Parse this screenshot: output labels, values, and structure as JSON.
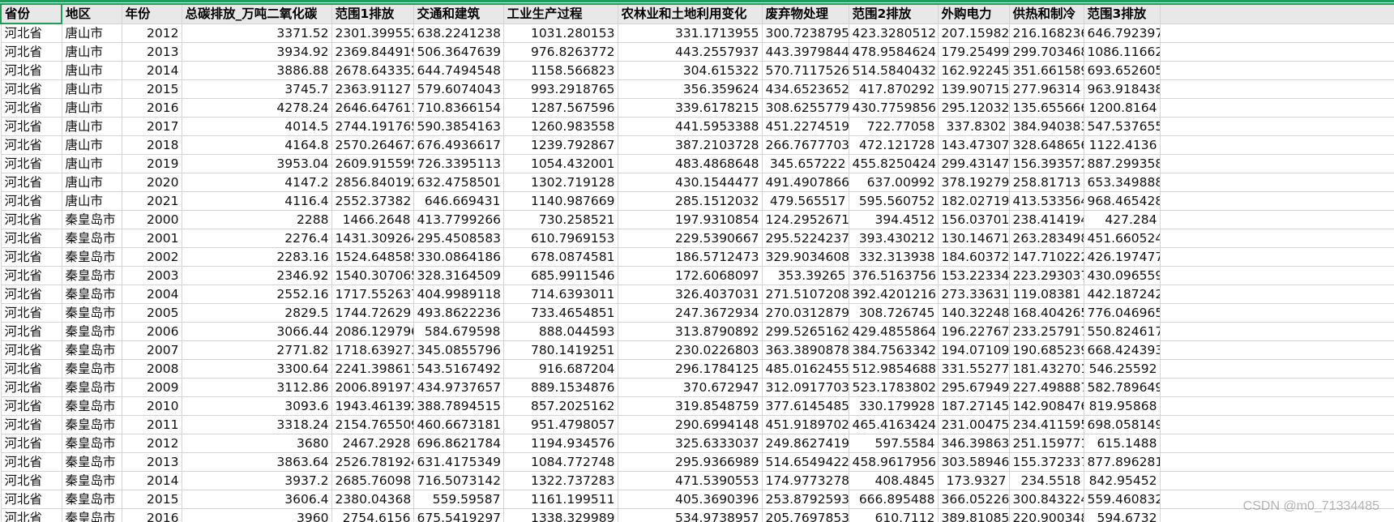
{
  "sheet": {
    "headers": [
      "省份",
      "地区",
      "年份",
      "总碳排放_万吨二氧化碳",
      "范围1排放",
      "交通和建筑",
      "工业生产过程",
      "农林业和土地利用变化",
      "废弃物处理",
      "范围2排放",
      "外购电力",
      "供热和制冷",
      "范围3排放"
    ],
    "rows": [
      [
        "河北省",
        "唐山市",
        "2012",
        "3371.52",
        "2301.399552",
        "638.2241238",
        "1031.280153",
        "331.1713955",
        "300.7238795",
        "423.3280512",
        "207.15982",
        "216.168236",
        "646.792397"
      ],
      [
        "河北省",
        "唐山市",
        "2013",
        "3934.92",
        "2369.844919",
        "506.3647639",
        "976.8263772",
        "443.2557937",
        "443.3979844",
        "478.9584624",
        "179.25499",
        "299.703468",
        "1086.11662"
      ],
      [
        "河北省",
        "唐山市",
        "2014",
        "3886.88",
        "2678.643352",
        "644.7494548",
        "1158.566823",
        "304.615322",
        "570.7117526",
        "514.5840432",
        "162.92245",
        "351.661589",
        "693.652605"
      ],
      [
        "河北省",
        "唐山市",
        "2015",
        "3745.7",
        "2363.91127",
        "579.6074043",
        "993.2918765",
        "356.359624",
        "434.6523652",
        "417.870292",
        "139.90715",
        "277.96314",
        "963.918438"
      ],
      [
        "河北省",
        "唐山市",
        "2016",
        "4278.24",
        "2646.647611",
        "710.8366154",
        "1287.567596",
        "339.6178215",
        "308.6255779",
        "430.7759856",
        "295.12032",
        "135.655666",
        "1200.8164"
      ],
      [
        "河北省",
        "唐山市",
        "2017",
        "4014.5",
        "2744.191765",
        "590.3854163",
        "1260.983558",
        "441.5953388",
        "451.2274519",
        "722.77058",
        "337.8302",
        "384.940383",
        "547.537655"
      ],
      [
        "河北省",
        "唐山市",
        "2018",
        "4164.8",
        "2570.264672",
        "676.4936617",
        "1239.792867",
        "387.2103728",
        "266.7677703",
        "472.121728",
        "143.47307",
        "328.648656",
        "1122.4136"
      ],
      [
        "河北省",
        "唐山市",
        "2019",
        "3953.04",
        "2609.915599",
        "726.3395113",
        "1054.432001",
        "483.4868648",
        "345.657222",
        "455.8250424",
        "299.43147",
        "156.393572",
        "887.299358"
      ],
      [
        "河北省",
        "唐山市",
        "2020",
        "4147.2",
        "2856.840192",
        "632.4758501",
        "1302.719128",
        "430.1544477",
        "491.4907866",
        "637.00992",
        "378.19279",
        "258.81713",
        "653.349888"
      ],
      [
        "河北省",
        "唐山市",
        "2021",
        "4116.4",
        "2552.37382",
        "646.669431",
        "1140.987669",
        "285.1512032",
        "479.565517",
        "595.560752",
        "182.02719",
        "413.533564",
        "968.465428"
      ],
      [
        "河北省",
        "秦皇岛市",
        "2000",
        "2288",
        "1466.2648",
        "413.7799266",
        "730.258521",
        "197.9310854",
        "124.2952671",
        "394.4512",
        "156.03701",
        "238.414194",
        "427.284"
      ],
      [
        "河北省",
        "秦皇岛市",
        "2001",
        "2276.4",
        "1431.309264",
        "295.4508583",
        "610.7969153",
        "229.5390667",
        "295.5224237",
        "393.430212",
        "130.14671",
        "263.283498",
        "451.660524"
      ],
      [
        "河北省",
        "秦皇岛市",
        "2002",
        "2283.16",
        "1524.648585",
        "330.0864186",
        "678.0874581",
        "186.5712473",
        "329.9034608",
        "332.313938",
        "184.60372",
        "147.710222",
        "426.197477"
      ],
      [
        "河北省",
        "秦皇岛市",
        "2003",
        "2346.92",
        "1540.307065",
        "328.3164509",
        "685.9911546",
        "172.6068097",
        "353.39265",
        "376.5163756",
        "153.22334",
        "223.293037",
        "430.096559"
      ],
      [
        "河北省",
        "秦皇岛市",
        "2004",
        "2552.16",
        "1717.552637",
        "404.9989118",
        "714.6393011",
        "326.4037031",
        "271.5107208",
        "392.4201216",
        "273.33631",
        "119.08381",
        "442.187242"
      ],
      [
        "河北省",
        "秦皇岛市",
        "2005",
        "2829.5",
        "1744.72629",
        "493.8622236",
        "733.4654851",
        "247.3672934",
        "270.0312879",
        "308.726745",
        "140.32248",
        "168.404265",
        "776.046965"
      ],
      [
        "河北省",
        "秦皇岛市",
        "2006",
        "3066.44",
        "2086.129796",
        "584.679598",
        "888.044593",
        "313.8790892",
        "299.5265162",
        "429.4855864",
        "196.22767",
        "233.257917",
        "550.824617"
      ],
      [
        "河北省",
        "秦皇岛市",
        "2007",
        "2771.82",
        "1718.639273",
        "345.0855796",
        "780.1419251",
        "230.0226803",
        "363.3890878",
        "384.7563342",
        "194.07109",
        "190.685239",
        "668.424393"
      ],
      [
        "河北省",
        "秦皇岛市",
        "2008",
        "3300.64",
        "2241.398611",
        "543.5167492",
        "916.687204",
        "296.1784125",
        "485.0162455",
        "512.9854688",
        "331.55277",
        "181.432701",
        "546.25592"
      ],
      [
        "河北省",
        "秦皇岛市",
        "2009",
        "3112.86",
        "2006.891971",
        "434.9737657",
        "889.1534876",
        "370.672947",
        "312.0917703",
        "523.1783802",
        "295.67949",
        "227.498887",
        "582.789649"
      ],
      [
        "河北省",
        "秦皇岛市",
        "2010",
        "3093.6",
        "1943.461392",
        "388.7894515",
        "857.2025162",
        "319.8548759",
        "377.6145485",
        "330.179928",
        "187.27145",
        "142.908476",
        "819.95868"
      ],
      [
        "河北省",
        "秦皇岛市",
        "2011",
        "3318.24",
        "2154.765509",
        "460.6673181",
        "951.4798057",
        "290.6994148",
        "451.9189702",
        "465.4163424",
        "231.00475",
        "234.411595",
        "698.058149"
      ],
      [
        "河北省",
        "秦皇岛市",
        "2012",
        "3680",
        "2467.2928",
        "696.8621784",
        "1194.934576",
        "325.6333037",
        "249.8627419",
        "597.5584",
        "346.39863",
        "251.159771",
        "615.1488"
      ],
      [
        "河北省",
        "秦皇岛市",
        "2013",
        "3863.64",
        "2526.781924",
        "631.4175349",
        "1084.772748",
        "295.9366989",
        "514.6549422",
        "458.9617956",
        "303.58946",
        "155.372337",
        "877.896281"
      ],
      [
        "河北省",
        "秦皇岛市",
        "2014",
        "3937.2",
        "2685.76098",
        "716.5073142",
        "1322.737283",
        "471.5390553",
        "174.9773278",
        "408.4845",
        "173.9327",
        "234.5518",
        "842.95452"
      ],
      [
        "河北省",
        "秦皇岛市",
        "2015",
        "3606.4",
        "2380.04368",
        "559.59587",
        "1161.199511",
        "405.3690396",
        "253.8792593",
        "666.895488",
        "366.05226",
        "300.843224",
        "559.460832"
      ],
      [
        "河北省",
        "秦皇岛市",
        "2016",
        "3960",
        "2754.6156",
        "675.5419297",
        "1338.329989",
        "534.9738957",
        "205.7697853",
        "610.7112",
        "389.81085",
        "220.900348",
        "594.6732"
      ]
    ]
  },
  "watermark": "CSDN @m0_71334485"
}
